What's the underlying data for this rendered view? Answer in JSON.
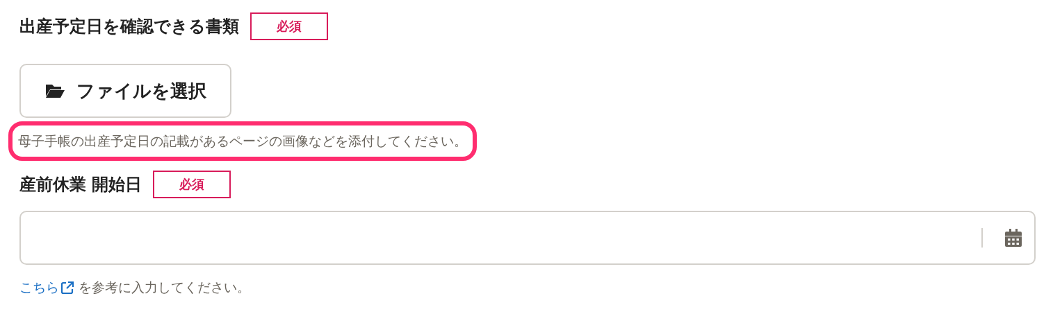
{
  "fields": [
    {
      "kind": "file",
      "label": "出産予定日を確認できる書類",
      "badge": "必須",
      "button": "ファイルを選択",
      "hint": {
        "text": "母子手帳の出産予定日の記載があるページの画像などを添付してください。",
        "highlighted": true
      }
    },
    {
      "kind": "date",
      "label": "産前休業 開始日",
      "badge": "必須",
      "note": {
        "link": "こちら",
        "text": "を参考に入力してください。"
      }
    }
  ]
}
